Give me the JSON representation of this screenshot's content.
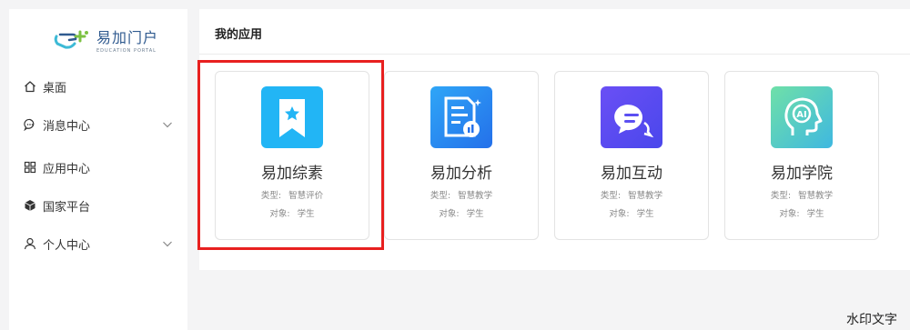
{
  "logo": {
    "title": "易加门户",
    "subtitle": "EDUCATION PORTAL",
    "icon": "education-portal-logo"
  },
  "sidebar": {
    "items": [
      {
        "label": "桌面",
        "icon": "home-icon",
        "expandable": false
      },
      {
        "label": "消息中心",
        "icon": "chat-bubble-icon",
        "expandable": true
      },
      {
        "label": "应用中心",
        "icon": "grid-icon",
        "expandable": false
      },
      {
        "label": "国家平台",
        "icon": "cube-icon",
        "expandable": false
      },
      {
        "label": "个人中心",
        "icon": "user-icon",
        "expandable": true
      }
    ]
  },
  "main": {
    "section_title": "我的应用",
    "cards": [
      {
        "name": "易加综素",
        "type_label": "类型:",
        "type_value": "智慧评价",
        "target_label": "对象:",
        "target_value": "学生",
        "icon": "bookmark-star-icon",
        "color": "#22b5f5"
      },
      {
        "name": "易加分析",
        "type_label": "类型:",
        "type_value": "智慧教学",
        "target_label": "对象:",
        "target_value": "学生",
        "icon": "document-chart-icon",
        "color": "#2b8cf3"
      },
      {
        "name": "易加互动",
        "type_label": "类型:",
        "type_value": "智慧教学",
        "target_label": "对象:",
        "target_value": "学生",
        "icon": "chat-bubbles-icon",
        "color": "#5b4ff2"
      },
      {
        "name": "易加学院",
        "type_label": "类型:",
        "type_value": "智慧教学",
        "target_label": "对象:",
        "target_value": "学生",
        "icon": "ai-head-icon",
        "color": "#4fd0c0"
      }
    ]
  },
  "highlight_color": "#e8201f",
  "watermark": "水印文字"
}
